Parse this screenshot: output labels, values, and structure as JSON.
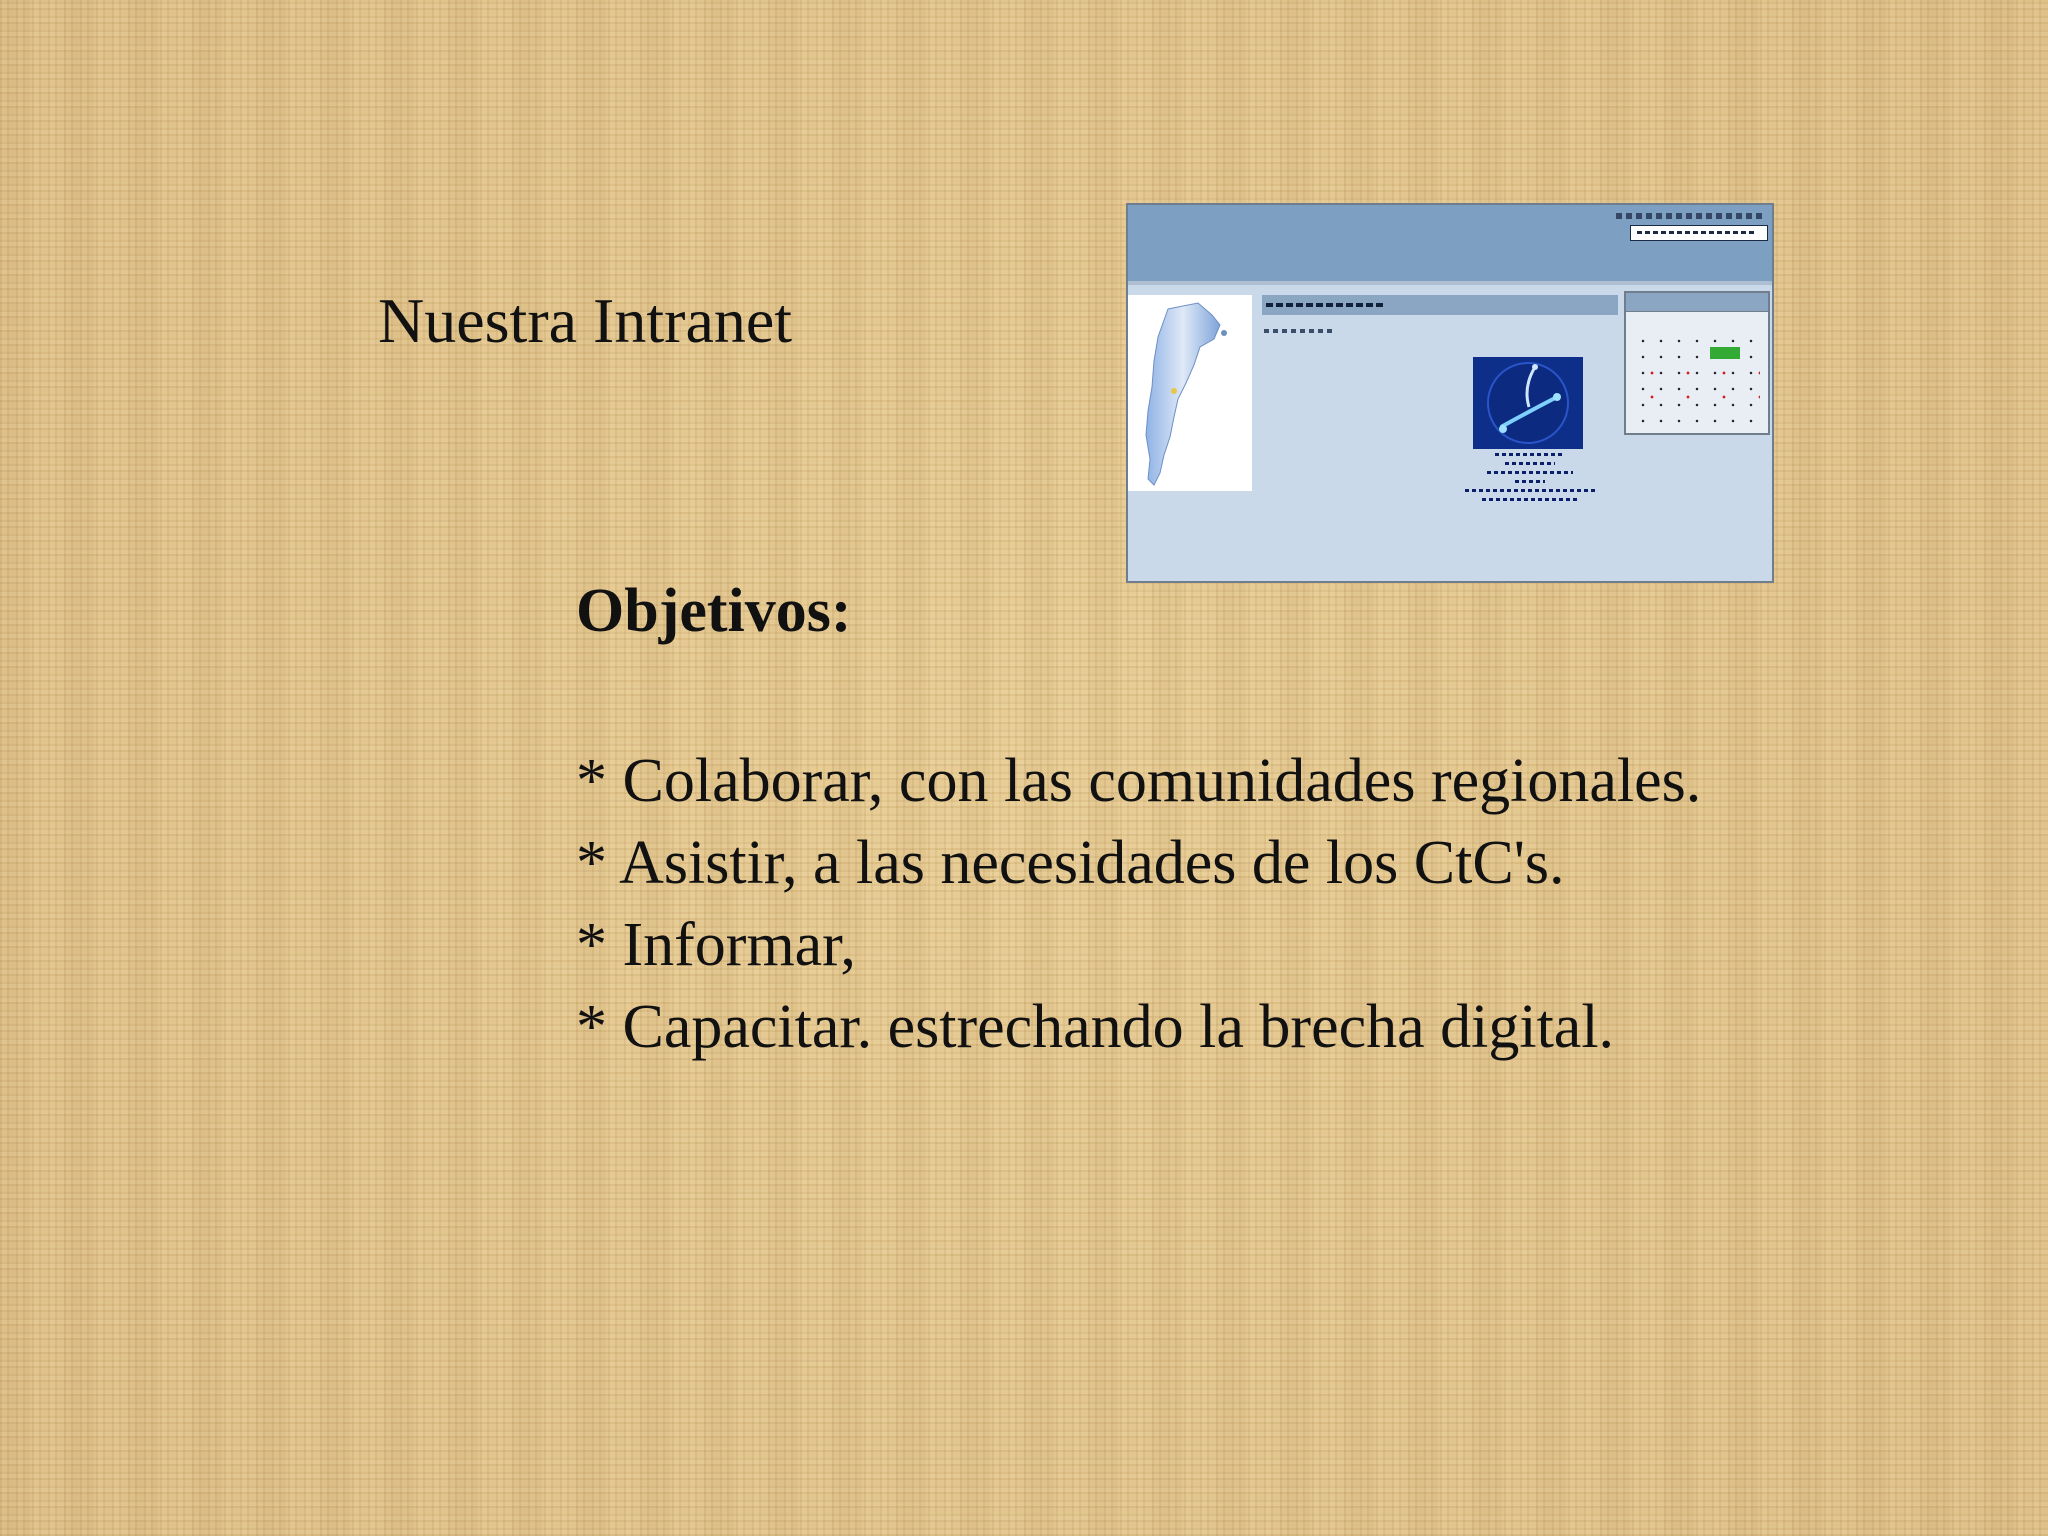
{
  "slide": {
    "title": "Nuestra Intranet",
    "objectives_heading": "Objetivos:",
    "objectives": [
      "* Colaborar, con las comunidades regionales.",
      "* Asistir, a las necesidades de los CtC's.",
      "* Informar,",
      "* Capacitar. estrechando la brecha digital."
    ]
  },
  "colors": {
    "background": "#e3c78e",
    "thumbnail_header": "#7d9fc2",
    "thumbnail_body": "#c9d9ea",
    "logo_blue": "#0d2f8a",
    "calendar_today": "#33aa33"
  }
}
